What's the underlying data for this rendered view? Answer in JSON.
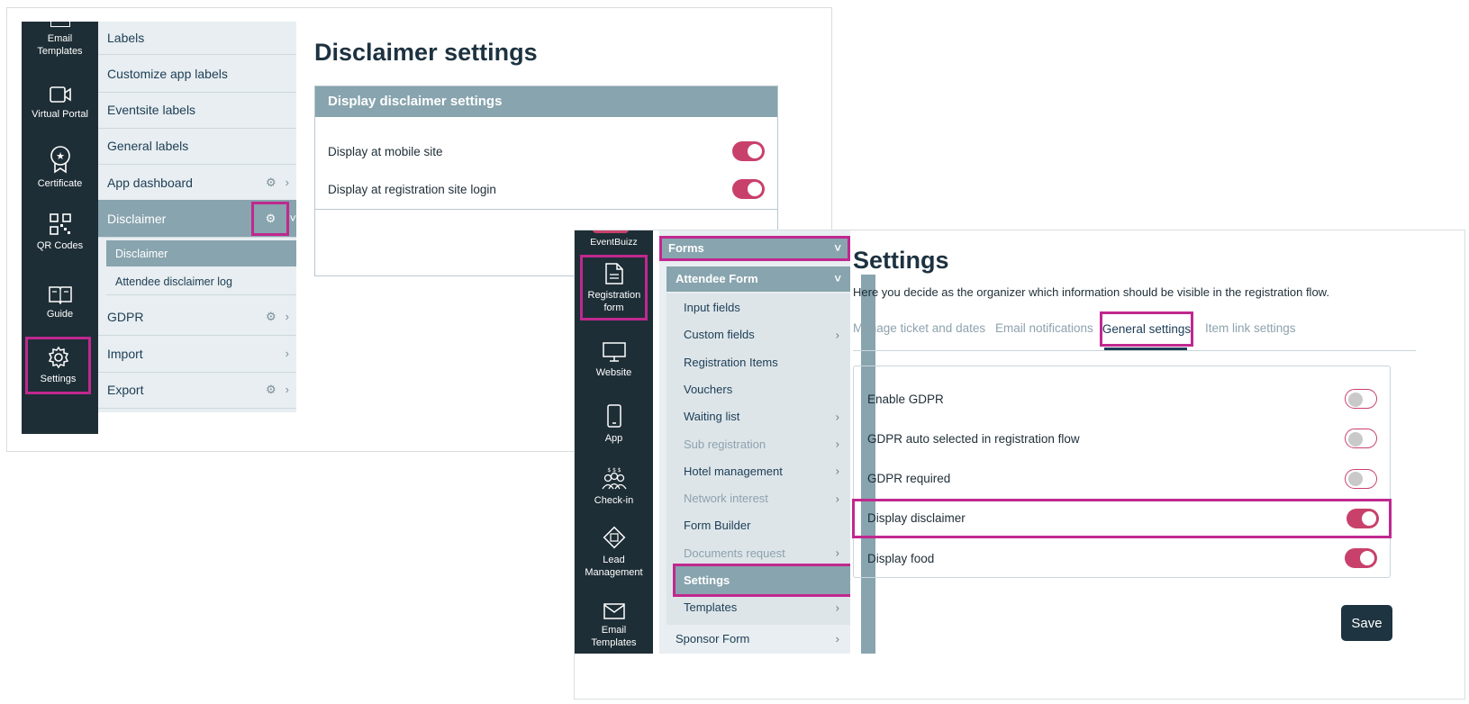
{
  "left_panel": {
    "rail": [
      {
        "label": "Email Templates",
        "icon": "email-icon"
      },
      {
        "label": "Virtual Portal",
        "icon": "video-camera-icon"
      },
      {
        "label": "Certificate",
        "icon": "certificate-icon"
      },
      {
        "label": "QR Codes",
        "icon": "qr-code-icon"
      },
      {
        "label": "Guide",
        "icon": "book-icon"
      },
      {
        "label": "Settings",
        "icon": "gear-icon"
      }
    ],
    "menu": [
      {
        "label": "Labels"
      },
      {
        "label": "Customize app labels"
      },
      {
        "label": "Eventsite labels"
      },
      {
        "label": "General labels"
      },
      {
        "label": "App dashboard"
      },
      {
        "label": "Disclaimer"
      },
      {
        "label": "GDPR"
      },
      {
        "label": "Import"
      },
      {
        "label": "Export"
      }
    ],
    "submenu": [
      "Disclaimer",
      "Attendee disclaimer log"
    ],
    "title": "Disclaimer settings",
    "card_header": "Display disclaimer settings",
    "rows": [
      {
        "label": "Display at mobile site",
        "on": true
      },
      {
        "label": "Display at registration site login",
        "on": true
      }
    ]
  },
  "right_panel": {
    "brand": "EventBuizz",
    "rail": [
      {
        "label": "Registration form",
        "icon": "document-icon"
      },
      {
        "label": "Website",
        "icon": "monitor-icon"
      },
      {
        "label": "App",
        "icon": "phone-icon"
      },
      {
        "label": "Check-in",
        "icon": "people-icon"
      },
      {
        "label": "Lead Management",
        "icon": "lead-icon"
      },
      {
        "label": "Email Templates",
        "icon": "email-icon"
      }
    ],
    "menu_header": "Forms",
    "submenu_header": "Attendee Form",
    "items": [
      {
        "label": "Input fields",
        "arrow": false,
        "muted": false
      },
      {
        "label": "Custom fields",
        "arrow": true,
        "muted": false
      },
      {
        "label": "Registration Items",
        "arrow": false,
        "muted": false
      },
      {
        "label": "Vouchers",
        "arrow": false,
        "muted": false
      },
      {
        "label": "Waiting list",
        "arrow": true,
        "muted": false
      },
      {
        "label": "Sub registration",
        "arrow": true,
        "muted": true
      },
      {
        "label": "Hotel management",
        "arrow": true,
        "muted": false
      },
      {
        "label": "Network interest",
        "arrow": true,
        "muted": true
      },
      {
        "label": "Form Builder",
        "arrow": false,
        "muted": false
      },
      {
        "label": "Documents request",
        "arrow": true,
        "muted": true
      },
      {
        "label": "Settings",
        "arrow": false,
        "muted": false
      },
      {
        "label": "Templates",
        "arrow": true,
        "muted": false
      }
    ],
    "sponsor_form": "Sponsor Form",
    "title": "Settings",
    "description": "Here you decide as the organizer which information should be visible in the registration flow.",
    "tabs": [
      "Manage ticket and dates",
      "Email notifications",
      "General settings",
      "Item link settings"
    ],
    "rows": [
      {
        "label": "Enable GDPR",
        "on": false
      },
      {
        "label": "GDPR auto selected in registration flow",
        "on": false
      },
      {
        "label": "GDPR required",
        "on": false
      },
      {
        "label": "Display disclaimer",
        "on": true
      },
      {
        "label": "Display food",
        "on": true
      }
    ],
    "save_label": "Save"
  },
  "colors": {
    "rail": "#1e2e36",
    "accent": "#c8416b",
    "highlight": "#c0288f",
    "header": "#88a4ae"
  }
}
